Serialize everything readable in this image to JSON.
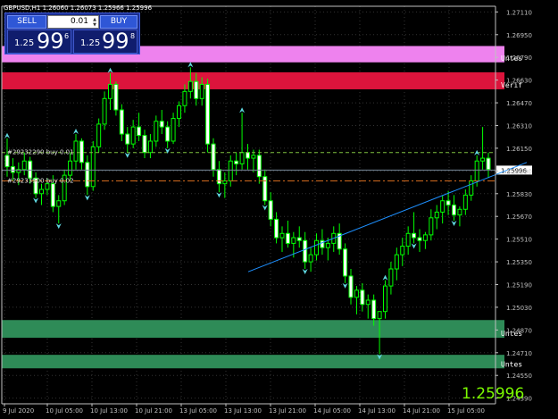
{
  "header": "GBPUSD,H1  1.26060 1.26073 1.25966 1.25996",
  "trade_panel": {
    "sell_label": "SELL",
    "buy_label": "BUY",
    "lot_value": "0.01",
    "sell_price": {
      "small": "1.25",
      "big": "99",
      "sup": "6"
    },
    "buy_price": {
      "small": "1.25",
      "big": "99",
      "sup": "8"
    }
  },
  "current_price": "1.25996",
  "chart_data": {
    "type": "candlestick",
    "symbol": "GBPUSD",
    "timeframe": "H1",
    "y_ticks": [
      "1.27110",
      "1.26950",
      "1.26790",
      "1.26630",
      "1.26470",
      "1.26310",
      "1.26150",
      "1.25990",
      "1.25830",
      "1.25670",
      "1.25510",
      "1.25350",
      "1.25190",
      "1.25030",
      "1.24870",
      "1.24710",
      "1.24550",
      "1.24390"
    ],
    "x_ticks": [
      "9 Jul 2020",
      "10 Jul 05:00",
      "10 Jul 13:00",
      "10 Jul 21:00",
      "13 Jul 05:00",
      "13 Jul 13:00",
      "13 Jul 21:00",
      "14 Jul 05:00",
      "14 Jul 13:00",
      "14 Jul 21:00",
      "15 Jul 05:00"
    ],
    "last_price": 1.25996,
    "ylim": [
      1.2435,
      1.2715
    ],
    "zones": [
      {
        "label": "Untes",
        "color": "#ee82ee",
        "y_top": 1.2687,
        "y_bottom": 1.26755
      },
      {
        "label": "Verif",
        "color": "#dc143c",
        "y_top": 1.26685,
        "y_bottom": 1.26565
      },
      {
        "label": "Untes",
        "color": "#2e8b57",
        "y_top": 1.2494,
        "y_bottom": 1.24815
      },
      {
        "label": "Untes",
        "color": "#2e8b57",
        "y_top": 1.24695,
        "y_bottom": 1.246
      }
    ],
    "order_lines": [
      {
        "label": "#29232290 buy 0.01",
        "price": 1.2612,
        "color": "#7fbf3f"
      },
      {
        "label": "#29233900 buy 0.02",
        "price": 1.2592,
        "color": "#d2691e"
      }
    ],
    "trendline": {
      "color": "#1e90ff",
      "from": [
        "13 Jul 14:00",
        1.2528
      ],
      "to": [
        "15 Jul 14:00",
        1.2605
      ]
    },
    "candles_ohlc": [
      [
        1.261,
        1.2622,
        1.2595,
        1.2602
      ],
      [
        1.2602,
        1.2608,
        1.2592,
        1.2598
      ],
      [
        1.2598,
        1.2605,
        1.2589,
        1.26
      ],
      [
        1.26,
        1.2612,
        1.2596,
        1.2606
      ],
      [
        1.2606,
        1.2609,
        1.259,
        1.2594
      ],
      [
        1.2594,
        1.2598,
        1.258,
        1.2583
      ],
      [
        1.2583,
        1.259,
        1.2575,
        1.2586
      ],
      [
        1.2586,
        1.2594,
        1.2582,
        1.259
      ],
      [
        1.259,
        1.2596,
        1.257,
        1.2574
      ],
      [
        1.2574,
        1.2582,
        1.2562,
        1.2578
      ],
      [
        1.2578,
        1.26,
        1.2575,
        1.2596
      ],
      [
        1.2596,
        1.2612,
        1.2592,
        1.2606
      ],
      [
        1.2606,
        1.2625,
        1.26,
        1.262
      ],
      [
        1.262,
        1.2622,
        1.26,
        1.2605
      ],
      [
        1.2605,
        1.261,
        1.2582,
        1.2588
      ],
      [
        1.2588,
        1.262,
        1.2585,
        1.2616
      ],
      [
        1.2616,
        1.2636,
        1.2612,
        1.2632
      ],
      [
        1.2632,
        1.2655,
        1.2628,
        1.265
      ],
      [
        1.265,
        1.2668,
        1.2642,
        1.266
      ],
      [
        1.266,
        1.2662,
        1.2638,
        1.2642
      ],
      [
        1.2642,
        1.2646,
        1.262,
        1.2625
      ],
      [
        1.2625,
        1.263,
        1.2612,
        1.2618
      ],
      [
        1.2618,
        1.2635,
        1.2615,
        1.263
      ],
      [
        1.263,
        1.264,
        1.262,
        1.2624
      ],
      [
        1.2624,
        1.2628,
        1.2608,
        1.2612
      ],
      [
        1.2612,
        1.2625,
        1.2608,
        1.262
      ],
      [
        1.262,
        1.2638,
        1.2616,
        1.2634
      ],
      [
        1.2634,
        1.2642,
        1.2625,
        1.263
      ],
      [
        1.263,
        1.2634,
        1.2615,
        1.262
      ],
      [
        1.262,
        1.264,
        1.2618,
        1.2636
      ],
      [
        1.2636,
        1.2648,
        1.263,
        1.2645
      ],
      [
        1.2645,
        1.266,
        1.264,
        1.2655
      ],
      [
        1.2655,
        1.2672,
        1.265,
        1.2662
      ],
      [
        1.2662,
        1.2668,
        1.2645,
        1.265
      ],
      [
        1.265,
        1.2665,
        1.2645,
        1.266
      ],
      [
        1.266,
        1.2664,
        1.2612,
        1.2618
      ],
      [
        1.2618,
        1.2622,
        1.2595,
        1.26
      ],
      [
        1.26,
        1.2606,
        1.2584,
        1.259
      ],
      [
        1.259,
        1.2598,
        1.258,
        1.2592
      ],
      [
        1.2592,
        1.261,
        1.2588,
        1.2606
      ],
      [
        1.2606,
        1.2612,
        1.2596,
        1.2604
      ],
      [
        1.2604,
        1.264,
        1.26,
        1.2612
      ],
      [
        1.2612,
        1.2618,
        1.26,
        1.2608
      ],
      [
        1.2608,
        1.2614,
        1.2598,
        1.261
      ],
      [
        1.261,
        1.2614,
        1.259,
        1.2595
      ],
      [
        1.2595,
        1.26,
        1.2575,
        1.2578
      ],
      [
        1.2578,
        1.2584,
        1.256,
        1.2565
      ],
      [
        1.2565,
        1.257,
        1.2548,
        1.2552
      ],
      [
        1.2552,
        1.256,
        1.2542,
        1.2555
      ],
      [
        1.2555,
        1.2564,
        1.2545,
        1.2548
      ],
      [
        1.2548,
        1.2556,
        1.2538,
        1.2552
      ],
      [
        1.2552,
        1.256,
        1.2545,
        1.255
      ],
      [
        1.255,
        1.2556,
        1.253,
        1.2535
      ],
      [
        1.2535,
        1.2545,
        1.2528,
        1.254
      ],
      [
        1.254,
        1.2555,
        1.2536,
        1.255
      ],
      [
        1.255,
        1.2558,
        1.254,
        1.2545
      ],
      [
        1.2545,
        1.2552,
        1.2536,
        1.2548
      ],
      [
        1.2548,
        1.256,
        1.2542,
        1.2555
      ],
      [
        1.2555,
        1.2562,
        1.254,
        1.2544
      ],
      [
        1.2544,
        1.2548,
        1.252,
        1.2525
      ],
      [
        1.2525,
        1.253,
        1.2505,
        1.251
      ],
      [
        1.251,
        1.2518,
        1.2498,
        1.2515
      ],
      [
        1.2515,
        1.252,
        1.25,
        1.2505
      ],
      [
        1.2505,
        1.2512,
        1.2495,
        1.2508
      ],
      [
        1.2508,
        1.2512,
        1.249,
        1.2495
      ],
      [
        1.2495,
        1.25,
        1.247,
        1.25
      ],
      [
        1.25,
        1.2522,
        1.2495,
        1.2518
      ],
      [
        1.2518,
        1.2535,
        1.2512,
        1.253
      ],
      [
        1.253,
        1.2545,
        1.2522,
        1.254
      ],
      [
        1.254,
        1.2552,
        1.2532,
        1.2546
      ],
      [
        1.2546,
        1.256,
        1.254,
        1.2555
      ],
      [
        1.2555,
        1.257,
        1.2548,
        1.2552
      ],
      [
        1.2552,
        1.2558,
        1.2542,
        1.255
      ],
      [
        1.255,
        1.2556,
        1.2544,
        1.2554
      ],
      [
        1.2554,
        1.2572,
        1.255,
        1.2566
      ],
      [
        1.2566,
        1.2575,
        1.2558,
        1.257
      ],
      [
        1.257,
        1.2582,
        1.2562,
        1.2578
      ],
      [
        1.2578,
        1.2585,
        1.2568,
        1.2575
      ],
      [
        1.2575,
        1.2582,
        1.2564,
        1.2568
      ],
      [
        1.2568,
        1.2574,
        1.256,
        1.2572
      ],
      [
        1.2572,
        1.2586,
        1.2568,
        1.2582
      ],
      [
        1.2582,
        1.2596,
        1.2578,
        1.2592
      ],
      [
        1.2592,
        1.261,
        1.2588,
        1.2606
      ],
      [
        1.2606,
        1.263,
        1.26,
        1.2608
      ],
      [
        1.2608,
        1.2612,
        1.2594,
        1.26
      ]
    ]
  }
}
